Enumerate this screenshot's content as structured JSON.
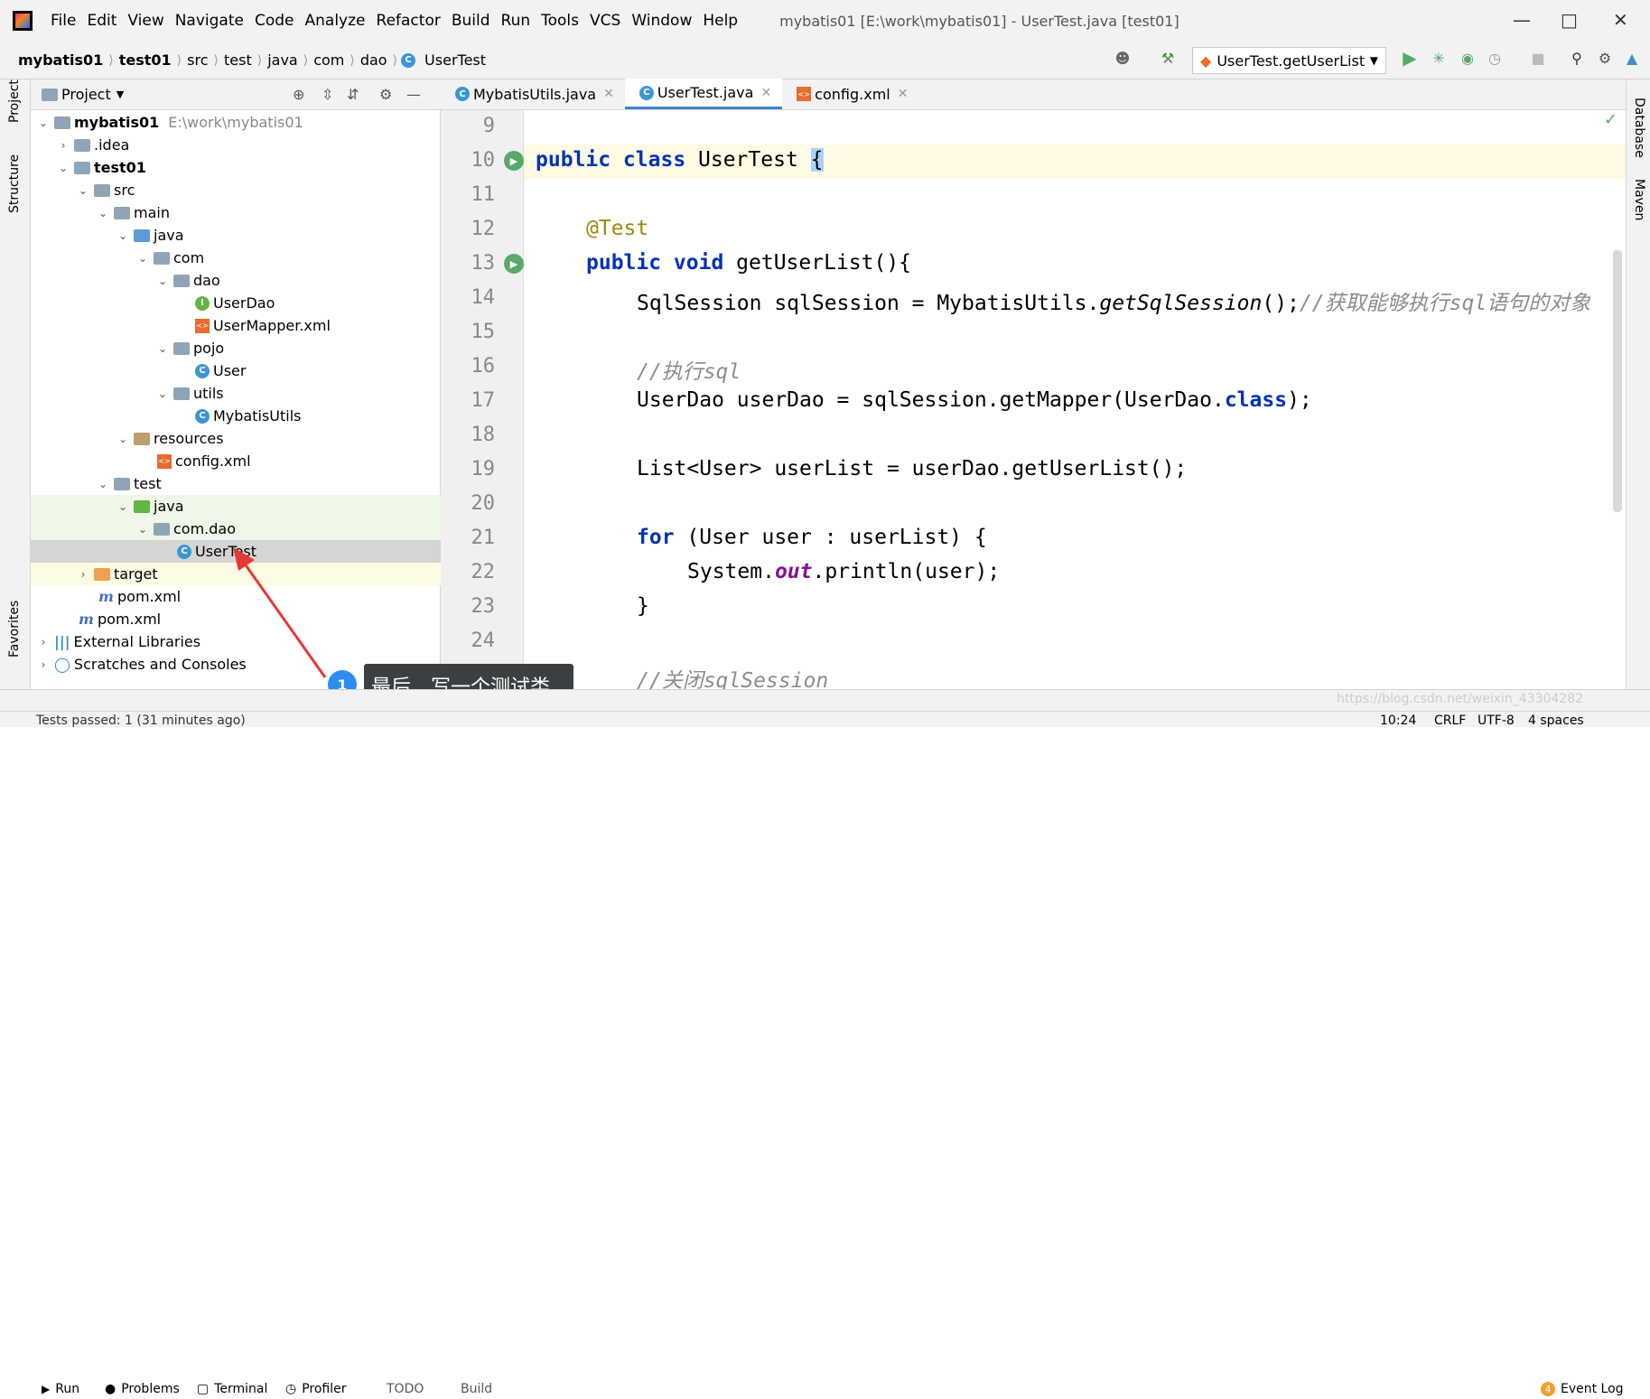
{
  "menu": [
    "File",
    "Edit",
    "View",
    "Navigate",
    "Code",
    "Analyze",
    "Refactor",
    "Build",
    "Run",
    "Tools",
    "VCS",
    "Window",
    "Help"
  ],
  "window_title": "mybatis01 [E:\\work\\mybatis01] - UserTest.java [test01]",
  "breadcrumb": [
    "mybatis01",
    "test01",
    "src",
    "test",
    "java",
    "com",
    "dao",
    "UserTest"
  ],
  "run_config": "UserTest.getUserList",
  "project_panel": {
    "title": "Project"
  },
  "tree": [
    {
      "label": "mybatis01",
      "path": "E:\\work\\mybatis01"
    },
    {
      "label": ".idea"
    },
    {
      "label": "test01"
    },
    {
      "label": "src"
    },
    {
      "label": "main"
    },
    {
      "label": "java"
    },
    {
      "label": "com"
    },
    {
      "label": "dao"
    },
    {
      "label": "UserDao"
    },
    {
      "label": "UserMapper.xml"
    },
    {
      "label": "pojo"
    },
    {
      "label": "User"
    },
    {
      "label": "utils"
    },
    {
      "label": "MybatisUtils"
    },
    {
      "label": "resources"
    },
    {
      "label": "config.xml"
    },
    {
      "label": "test"
    },
    {
      "label": "java"
    },
    {
      "label": "com.dao"
    },
    {
      "label": "UserTest"
    },
    {
      "label": "target"
    },
    {
      "label": "pom.xml"
    },
    {
      "label": "pom.xml"
    },
    {
      "label": "External Libraries"
    },
    {
      "label": "Scratches and Consoles"
    }
  ],
  "tabs": [
    {
      "label": "MybatisUtils.java"
    },
    {
      "label": "UserTest.java"
    },
    {
      "label": "config.xml"
    }
  ],
  "line_numbers": [
    "9",
    "10",
    "11",
    "12",
    "13",
    "14",
    "15",
    "16",
    "17",
    "18",
    "19",
    "20",
    "21",
    "22",
    "23",
    "24"
  ],
  "code": {
    "l10_kw": "public class ",
    "l10_name": "UserTest ",
    "l10_brace": "{",
    "l12": "@Test",
    "l13_kw": "public void ",
    "l13_rest": "getUserList(){",
    "l14_a": "SqlSession sqlSession = MybatisUtils.",
    "l14_b": "getSqlSession",
    "l14_c": "();",
    "l14_cm": "//获取能够执行sql语句的对象",
    "l16_cm": "//执行sql",
    "l17_a": "UserDao userDao = sqlSession.getMapper(UserDao.",
    "l17_kw": "class",
    "l17_c": ");",
    "l19": "List<User> userList = userDao.getUserList();",
    "l21_kw": "for",
    "l21_rest": " (User user : userList) {",
    "l22_a": "System.",
    "l22_b": "out",
    "l22_c": ".println(user);",
    "l23": "}",
    "l25_cm": "//关闭sqlSession"
  },
  "side_left": {
    "project": "Project",
    "structure": "Structure",
    "favorites": "Favorites"
  },
  "side_right": {
    "database": "Database",
    "maven": "Maven"
  },
  "tool_windows": [
    "Run",
    "Problems",
    "Terminal",
    "Profiler",
    "TODO",
    "Build"
  ],
  "event_log": {
    "count": "4",
    "label": "Event Log"
  },
  "status": {
    "message": "Tests passed: 1 (31 minutes ago)",
    "position": "10:24",
    "line_sep": "CRLF",
    "encoding": "UTF-8",
    "indent": "4 spaces"
  },
  "tooltip": {
    "badge": "1",
    "text": "最后，写一个测试类"
  },
  "watermark": "https://blog.csdn.net/weixin_43304282"
}
